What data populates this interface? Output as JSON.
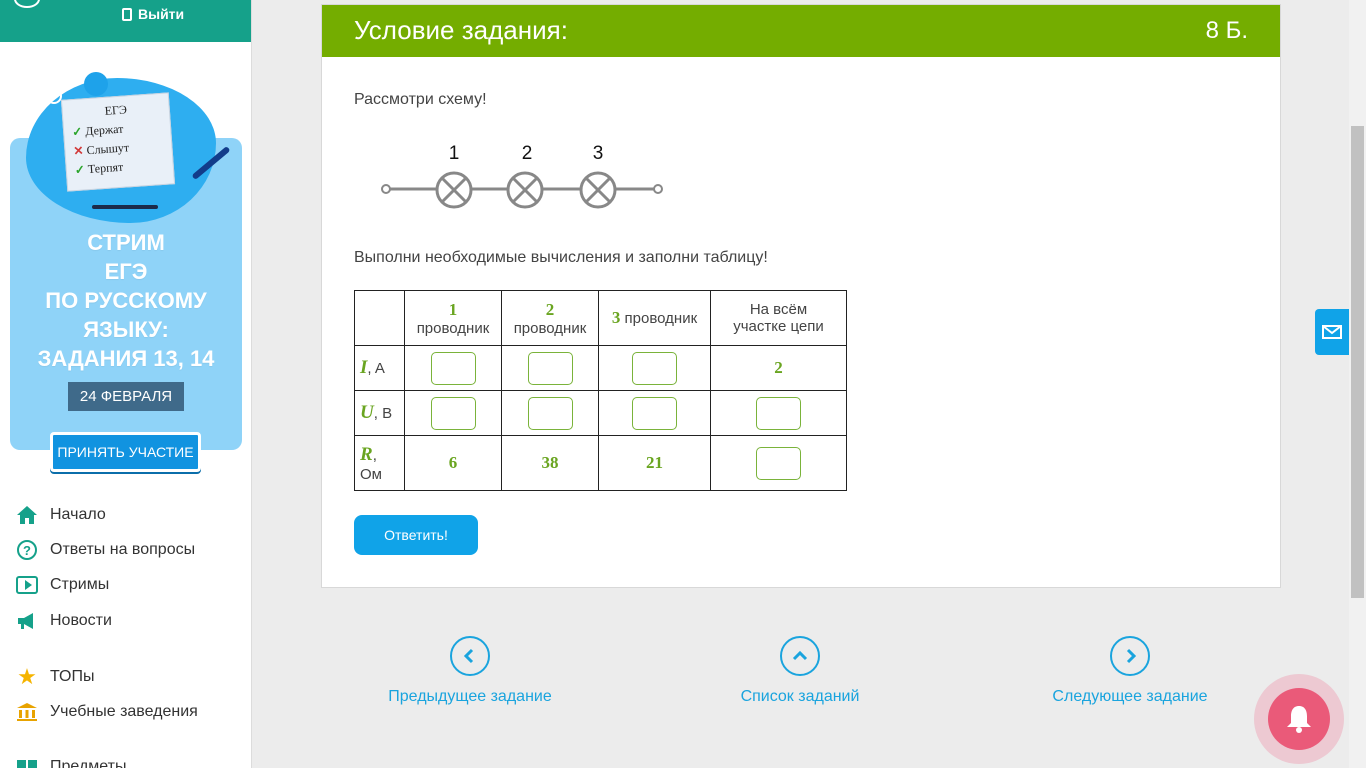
{
  "sidebar": {
    "logout_label": "Выйти",
    "promo": {
      "note_title": "ЕГЭ",
      "note_lines": [
        "Держат",
        "Слышут",
        "Терпят"
      ],
      "title_lines": [
        "СТРИМ",
        "ЕГЭ",
        "ПО РУССКОМУ",
        "ЯЗЫКУ:",
        "ЗАДАНИЯ 13, 14"
      ],
      "date": "24 ФЕВРАЛЯ",
      "button": "ПРИНЯТЬ УЧАСТИЕ"
    },
    "nav": [
      {
        "label": "Начало",
        "icon": "home-icon"
      },
      {
        "label": "Ответы на вопросы",
        "icon": "question-icon"
      },
      {
        "label": "Стримы",
        "icon": "play-icon"
      },
      {
        "label": "Новости",
        "icon": "megaphone-icon"
      },
      {
        "label": "ТОПы",
        "icon": "star-icon"
      },
      {
        "label": "Учебные заведения",
        "icon": "institution-icon"
      },
      {
        "label": "Предметы",
        "icon": "book-icon"
      }
    ]
  },
  "task": {
    "header_title": "Условие задания:",
    "points": "8 Б.",
    "intro": "Рассмотри схему!",
    "circuit_labels": [
      "1",
      "2",
      "3"
    ],
    "instruction": "Выполни необходимые вычисления и заполни таблицу!",
    "table": {
      "col1_num": "1",
      "col1_word": "проводник",
      "col2_num": "2",
      "col2_word": "проводник",
      "col3_num": "3",
      "col3_word": "проводник",
      "col4": [
        "На всём",
        "участке цепи"
      ],
      "row_i_var": "I",
      "row_i_unit": ", A",
      "row_u_var": "U",
      "row_u_unit": ", В",
      "row_r_var": "R",
      "row_r_unit": "Ом",
      "i_total": "2",
      "r1": "6",
      "r2": "38",
      "r3": "21"
    },
    "answer_button": "Ответить!"
  },
  "bottom_nav": {
    "prev": "Предыдущее задание",
    "list": "Список заданий",
    "next": "Следующее задание"
  },
  "colors": {
    "header_green": "#74ad00",
    "sidebar_teal": "#15a18a",
    "accent_blue": "#10a3e8",
    "value_green": "#6aa521",
    "bell_pink": "#ea5a79"
  }
}
